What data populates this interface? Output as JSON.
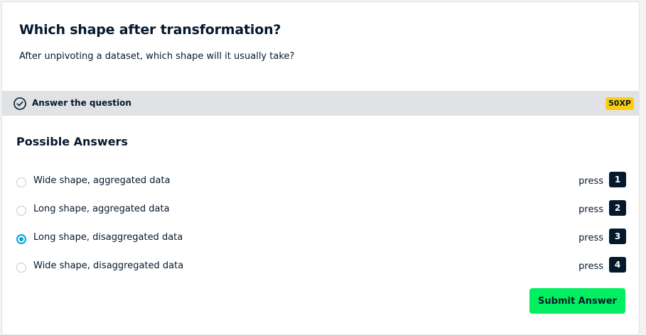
{
  "question": {
    "title": "Which shape after transformation?",
    "description": "After unpivoting a dataset, which shape will it usually take?"
  },
  "banner": {
    "label": "Answer the question",
    "icon": "check-circle-icon",
    "xp": "50XP",
    "xp_color": "#fcce0d"
  },
  "answers": {
    "heading": "Possible Answers",
    "press_label": "press",
    "selected_index": 2,
    "options": [
      {
        "label": "Wide shape, aggregated data",
        "key": "1"
      },
      {
        "label": "Long shape, aggregated data",
        "key": "2"
      },
      {
        "label": "Long shape, disaggregated data",
        "key": "3"
      },
      {
        "label": "Wide shape, disaggregated data",
        "key": "4"
      }
    ]
  },
  "submit": {
    "label": "Submit Answer",
    "color": "#03ef62"
  }
}
